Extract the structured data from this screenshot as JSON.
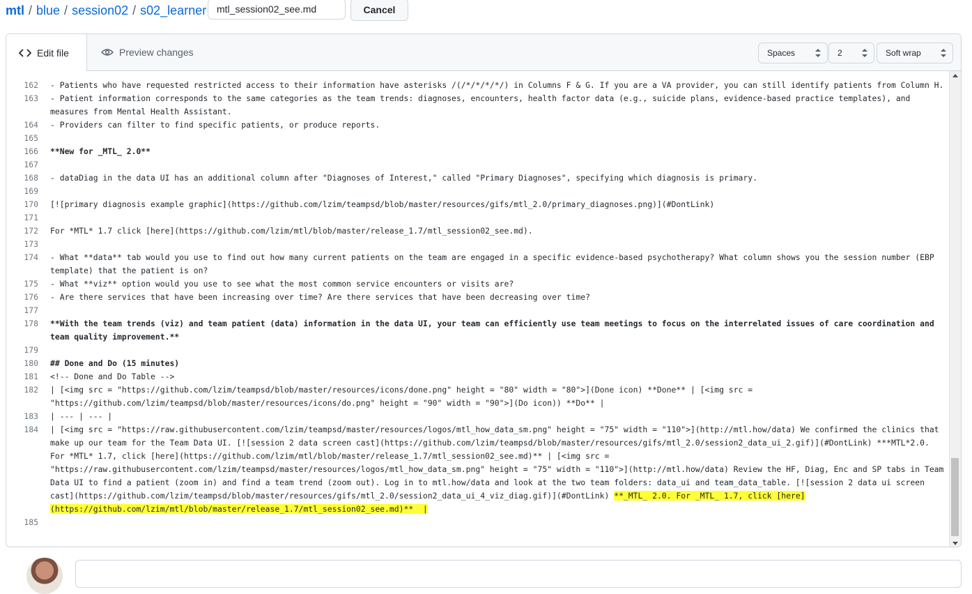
{
  "breadcrumb": {
    "root": "mtl",
    "items": [
      "blue",
      "session02",
      "s02_learner"
    ],
    "separator": "/"
  },
  "filename": {
    "value": "mtl_session02_see.md"
  },
  "cancel_label": "Cancel",
  "tabs": {
    "edit": "Edit file",
    "preview": "Preview changes"
  },
  "options": {
    "indent_mode": "Spaces",
    "indent_size": "2",
    "wrap_mode": "Soft wrap"
  },
  "lines": [
    {
      "num": "162",
      "text": "- Patients who have requested restricted access to their information have asterisks /(/*/*/*/*/) in Columns F & G. If you are a VA provider, you can still identify patients from Column H."
    },
    {
      "num": "163",
      "text": "- Patient information corresponds to the same categories as the team trends: diagnoses, encounters, health factor data (e.g., suicide plans, evidence-based practice templates), and measures from Mental Health Assistant."
    },
    {
      "num": "164",
      "text": "- Providers can filter to find specific patients, or produce reports."
    },
    {
      "num": "165",
      "text": ""
    },
    {
      "num": "166",
      "text": "**New for _MTL_ 2.0**",
      "bold": true
    },
    {
      "num": "167",
      "text": ""
    },
    {
      "num": "168",
      "text": "- dataDiag in the data UI has an additional column after \"Diagnoses of Interest,\" called \"Primary Diagnoses\", specifying which diagnosis is primary."
    },
    {
      "num": "169",
      "text": ""
    },
    {
      "num": "170",
      "text": "[![primary diagnosis example graphic](https://github.com/lzim/teampsd/blob/master/resources/gifs/mtl_2.0/primary_diagnoses.png)](#DontLink)"
    },
    {
      "num": "171",
      "text": ""
    },
    {
      "num": "172",
      "text": "For *MTL* 1.7 click [here](https://github.com/lzim/mtl/blob/master/release_1.7/mtl_session02_see.md)."
    },
    {
      "num": "173",
      "text": ""
    },
    {
      "num": "174",
      "text": "- What **data** tab would you use to find out how many current patients on the team are engaged in a specific evidence-based psychotherapy? What column shows you the session number (EBP template) that the patient is on?"
    },
    {
      "num": "175",
      "text": "- What **viz** option would you use to see what the most common service encounters or visits are?"
    },
    {
      "num": "176",
      "text": "- Are there services that have been increasing over time? Are there services that have been decreasing over time?"
    },
    {
      "num": "177",
      "text": ""
    },
    {
      "num": "178",
      "text": "**With the team trends (viz) and team patient (data) information in the data UI, your team can efficiently use team meetings to focus on the interrelated issues of care coordination and team quality improvement.**",
      "bold": true
    },
    {
      "num": "179",
      "text": ""
    },
    {
      "num": "180",
      "text": "## Done and Do (15 minutes)",
      "bold": true
    },
    {
      "num": "181",
      "text": "<!-- Done and Do Table -->"
    },
    {
      "num": "182",
      "text": "| [<img src = \"https://github.com/lzim/teampsd/blob/master/resources/icons/done.png\" height = \"80\" width = \"80\">](Done icon) **Done** | [<img src = \"https://github.com/lzim/teampsd/blob/master/resources/icons/do.png\" height = \"90\" width = \"90\">](Do icon)) **Do** |"
    },
    {
      "num": "183",
      "text": "| --- | --- |"
    },
    {
      "num": "184",
      "text": "| [<img src = \"https://raw.githubusercontent.com/lzim/teampsd/master/resources/logos/mtl_how_data_sm.png\" height = \"75\" width = \"110\">](http://mtl.how/data) We confirmed the clinics that make up our team for the Team Data UI. [![session 2 data screen cast](https://github.com/lzim/teampsd/blob/master/resources/gifs/mtl_2.0/session2_data_ui_2.gif)](#DontLink) ***MTL*2.0. For *MTL* 1.7, click [here](https://github.com/lzim/mtl/blob/master/release_1.7/mtl_session02_see.md)** | [<img src = \"https://raw.githubusercontent.com/lzim/teampsd/master/resources/logos/mtl_how_data_sm.png\" height = \"75\" width = \"110\">](http://mtl.how/data) Review the HF, Diag, Enc and SP tabs in Team Data UI to find a patient (zoom in) and find a team trend (zoom out). Log in to mtl.how/data and look at the two team folders: data_ui and team_data_table. [![session 2 data ui screen cast](https://github.com/lzim/teampsd/blob/master/resources/gifs/mtl_2.0/session2_data_ui_4_viz_diag.gif)](#DontLink) ",
      "highlight": "**_MTL_ 2.0. For _MTL_ 1.7, click [here](https://github.com/lzim/mtl/blob/master/release_1.7/mtl_session02_see.md)**  |"
    },
    {
      "num": "185",
      "text": ""
    }
  ],
  "colors": {
    "link": "#0969da",
    "highlight": "#ffff33",
    "border": "#d0d7de",
    "header_bg": "#f6f8fa"
  }
}
